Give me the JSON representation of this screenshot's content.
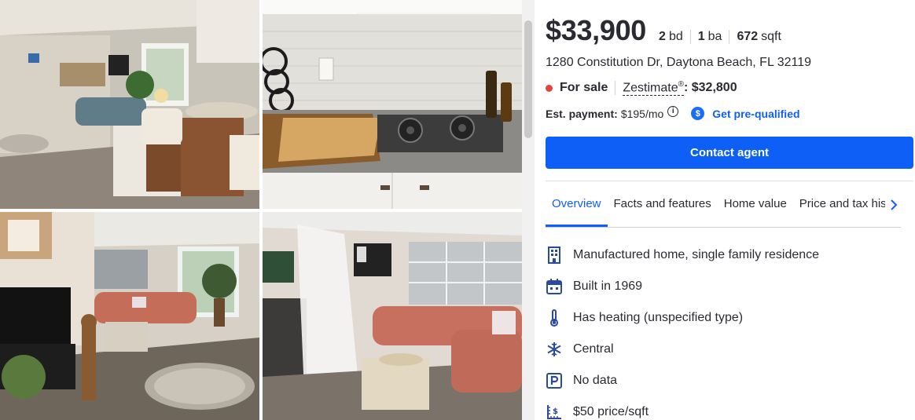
{
  "photos": [
    {
      "alt": "living room with bar stools"
    },
    {
      "alt": "kitchen stove top"
    },
    {
      "alt": "living room with television"
    },
    {
      "alt": "sitting room with couch"
    }
  ],
  "listing": {
    "price": "$33,900",
    "beds_value": "2",
    "beds_unit": "bd",
    "baths_value": "1",
    "baths_unit": "ba",
    "sqft_value": "672",
    "sqft_unit": "sqft",
    "address": "1280 Constitution Dr, Daytona Beach, FL 32119",
    "status": "For sale",
    "zestimate_label": "Zestimate",
    "zestimate_mark": "®",
    "zestimate_value": ": $32,800",
    "payment_label": "Est. payment:",
    "payment_value": "$195/mo",
    "info_glyph": "i",
    "dollar_glyph": "$",
    "prequal_label": "Get pre-qualified",
    "contact_label": "Contact agent"
  },
  "colors": {
    "status_dot": "#e5433f",
    "primary": "#0d5ff5",
    "link": "#0f60f0",
    "text": "#2a2a33"
  },
  "tabs": [
    {
      "label": "Overview",
      "active": true
    },
    {
      "label": "Facts and features",
      "active": false
    },
    {
      "label": "Home value",
      "active": false
    },
    {
      "label": "Price and tax history",
      "active": false
    }
  ],
  "features": [
    {
      "icon": "building-icon",
      "text": "Manufactured home, single family residence"
    },
    {
      "icon": "calendar-icon",
      "text": "Built in 1969"
    },
    {
      "icon": "thermometer-icon",
      "text": "Has heating (unspecified type)"
    },
    {
      "icon": "snowflake-icon",
      "text": "Central"
    },
    {
      "icon": "parking-icon",
      "text": "No data"
    },
    {
      "icon": "price-per-sqft-icon",
      "text": "$50 price/sqft"
    }
  ]
}
